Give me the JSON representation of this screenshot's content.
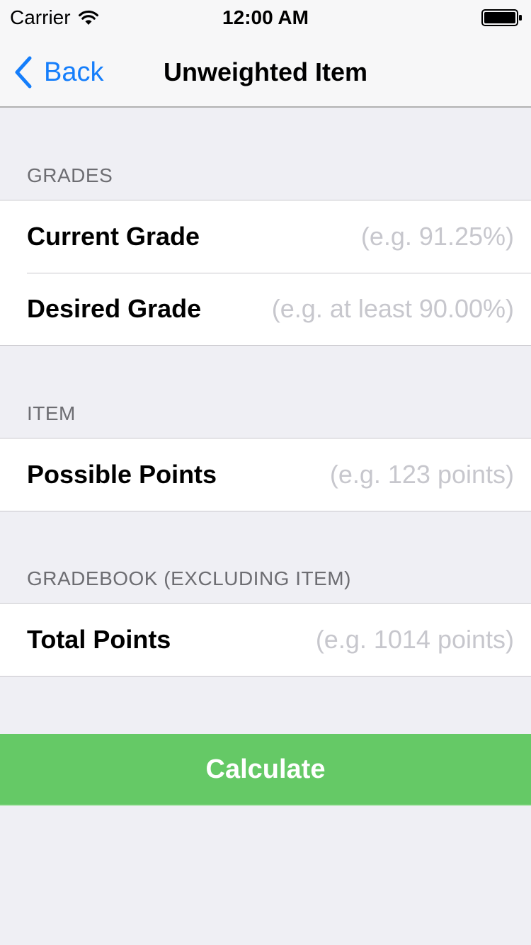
{
  "status_bar": {
    "carrier": "Carrier",
    "time": "12:00 AM",
    "icons": [
      "wifi-icon",
      "battery-icon"
    ]
  },
  "nav": {
    "back_label": "Back",
    "back_icon": "chevron-left-icon",
    "title": "Unweighted Item",
    "accent_color": "#157efb"
  },
  "sections": {
    "grades": {
      "header": "GRADES",
      "rows": [
        {
          "label": "Current Grade",
          "value": "",
          "placeholder": "(e.g. 91.25%)"
        },
        {
          "label": "Desired Grade",
          "value": "",
          "placeholder": "(e.g. at least 90.00%)"
        }
      ]
    },
    "item": {
      "header": "ITEM",
      "rows": [
        {
          "label": "Possible Points",
          "value": "",
          "placeholder": "(e.g. 123 points)"
        }
      ]
    },
    "gradebook": {
      "header": "GRADEBOOK (EXCLUDING ITEM)",
      "rows": [
        {
          "label": "Total Points",
          "value": "",
          "placeholder": "(e.g. 1014 points)"
        }
      ]
    }
  },
  "calculate": {
    "label": "Calculate",
    "color": "#65c966"
  }
}
